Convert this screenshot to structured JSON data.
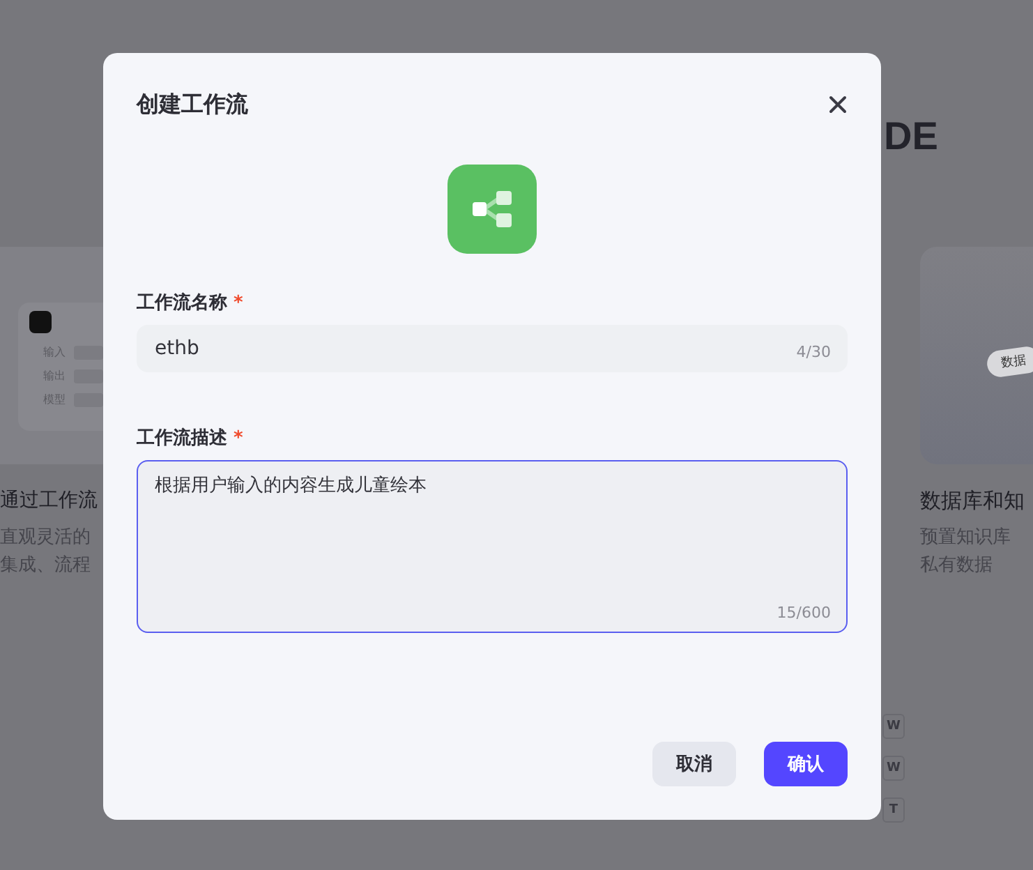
{
  "background": {
    "heading": "DE",
    "cards": [
      {
        "kind": "workflow",
        "title": "通过工作流",
        "description": [
          "直观灵活的",
          "集成、流程"
        ],
        "preview_labels": [
          "输入",
          "输出",
          "模型"
        ]
      },
      {
        "kind": "database",
        "title": "数据库和知",
        "description": [
          "预置知识库",
          "私有数据"
        ],
        "tag": "数据"
      }
    ],
    "badges": [
      "W",
      "W",
      "T"
    ]
  },
  "dialog": {
    "title": "创建工作流",
    "fields": [
      {
        "kind": "input",
        "label": "工作流名称",
        "required_mark": "*",
        "value": "ethb",
        "count": "4/30",
        "focused": false
      },
      {
        "kind": "textarea",
        "label": "工作流描述",
        "required_mark": "*",
        "value": "根据用户输入的内容生成儿童绘本",
        "count": "15/600",
        "focused": true
      }
    ],
    "buttons": [
      {
        "label": "取消",
        "kind": "secondary"
      },
      {
        "label": "确认",
        "kind": "primary"
      }
    ]
  }
}
